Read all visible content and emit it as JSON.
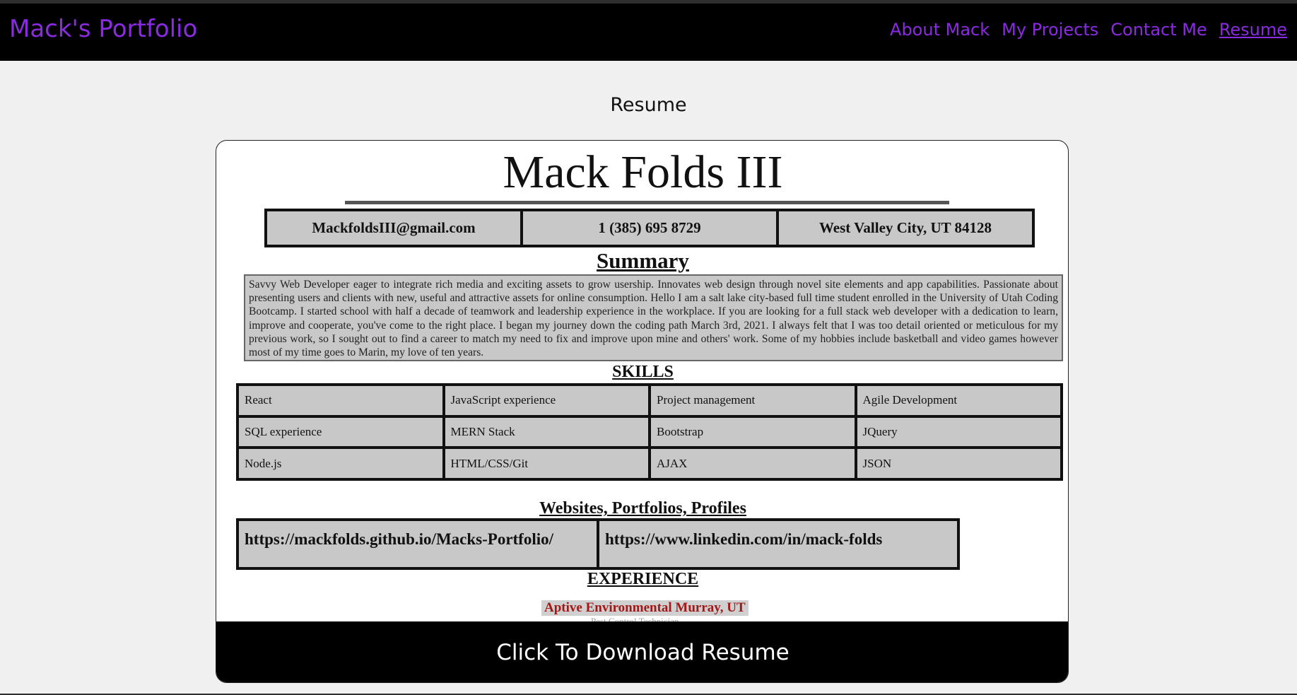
{
  "navbar": {
    "brand": "Mack's Portfolio",
    "links": [
      "About Mack",
      "My Projects",
      "Contact Me",
      "Resume"
    ],
    "active": "Resume"
  },
  "page": {
    "section_title": "Resume",
    "download_label": "Click To Download Resume"
  },
  "resume": {
    "name": "Mack Folds III",
    "contact": [
      "MackfoldsIII@gmail.com",
      "1 (385) 695 8729",
      "West Valley City, UT 84128"
    ],
    "summary_heading": "Summary",
    "summary": "Savvy Web Developer eager to integrate rich media and exciting assets to grow usership. Innovates web design through novel site elements and app capabilities. Passionate about presenting users and clients with new, useful and attractive assets for online consumption. Hello I am a salt lake city-based full time student enrolled in the University of Utah Coding Bootcamp. I started school with half a decade of teamwork and leadership experience in the workplace. If you are looking for a full stack web developer with a dedication to learn, improve and cooperate, you've come to the right place. I began my journey down the coding path March 3rd, 2021. I always felt that I was too detail oriented or meticulous for my previous work, so I sought out to find a career to match my need to fix and improve upon mine and others' work. Some of my hobbies include basketball and video games however most of my time goes to Marin, my love of ten years.",
    "skills_heading": "SKILLS",
    "skills": [
      "React",
      "JavaScript experience",
      "Project management",
      "Agile Development",
      "SQL experience",
      "MERN Stack",
      "Bootstrap",
      "JQuery",
      "Node.js",
      "HTML/CSS/Git",
      "AJAX",
      "JSON"
    ],
    "sites_heading": "Websites, Portfolios, Profiles",
    "sites": [
      "https://mackfolds.github.io/Macks-Portfolio/",
      "https://www.linkedin.com/in/mack-folds"
    ],
    "experience_heading": "EXPERIENCE",
    "job_title": "Aptive Environmental Murray, UT",
    "job_role": "Pest Control Technician"
  },
  "colors": {
    "accent": "#8a2be2",
    "navbar_bg": "#000000",
    "page_bg": "#f0f0f0",
    "cell_bg": "#c8c8c8",
    "job_title": "#a01818"
  }
}
